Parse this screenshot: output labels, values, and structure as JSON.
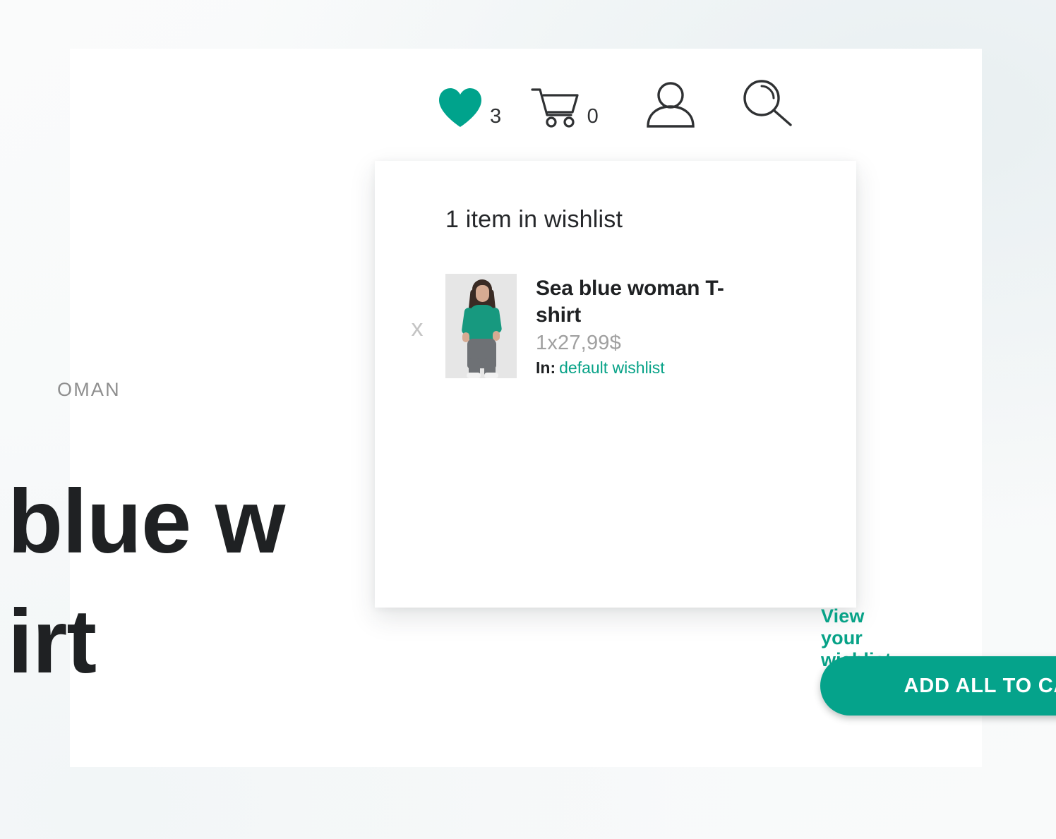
{
  "header": {
    "wishlist": {
      "icon": "heart-icon",
      "count": "3",
      "color": "#00a38c"
    },
    "cart": {
      "icon": "shopping-cart-icon",
      "count": "0"
    },
    "account": {
      "icon": "user-icon"
    },
    "search": {
      "icon": "search-icon"
    }
  },
  "background_page": {
    "category": "OMAN",
    "product_title": "blue w\nirt"
  },
  "wishlist_panel": {
    "heading": "1 item in wishlist",
    "remove_label": "x",
    "item": {
      "title": "Sea blue woman T-shirt",
      "price": "1x27,99$",
      "list_label": "In:",
      "list_name": "default wishlist",
      "thumbnail": "woman-wearing-teal-tshirt-and-grey-joggers"
    },
    "view_link": "View your wishlist >",
    "add_all_button": "ADD ALL TO CART",
    "accent_color": "#05a38b"
  }
}
